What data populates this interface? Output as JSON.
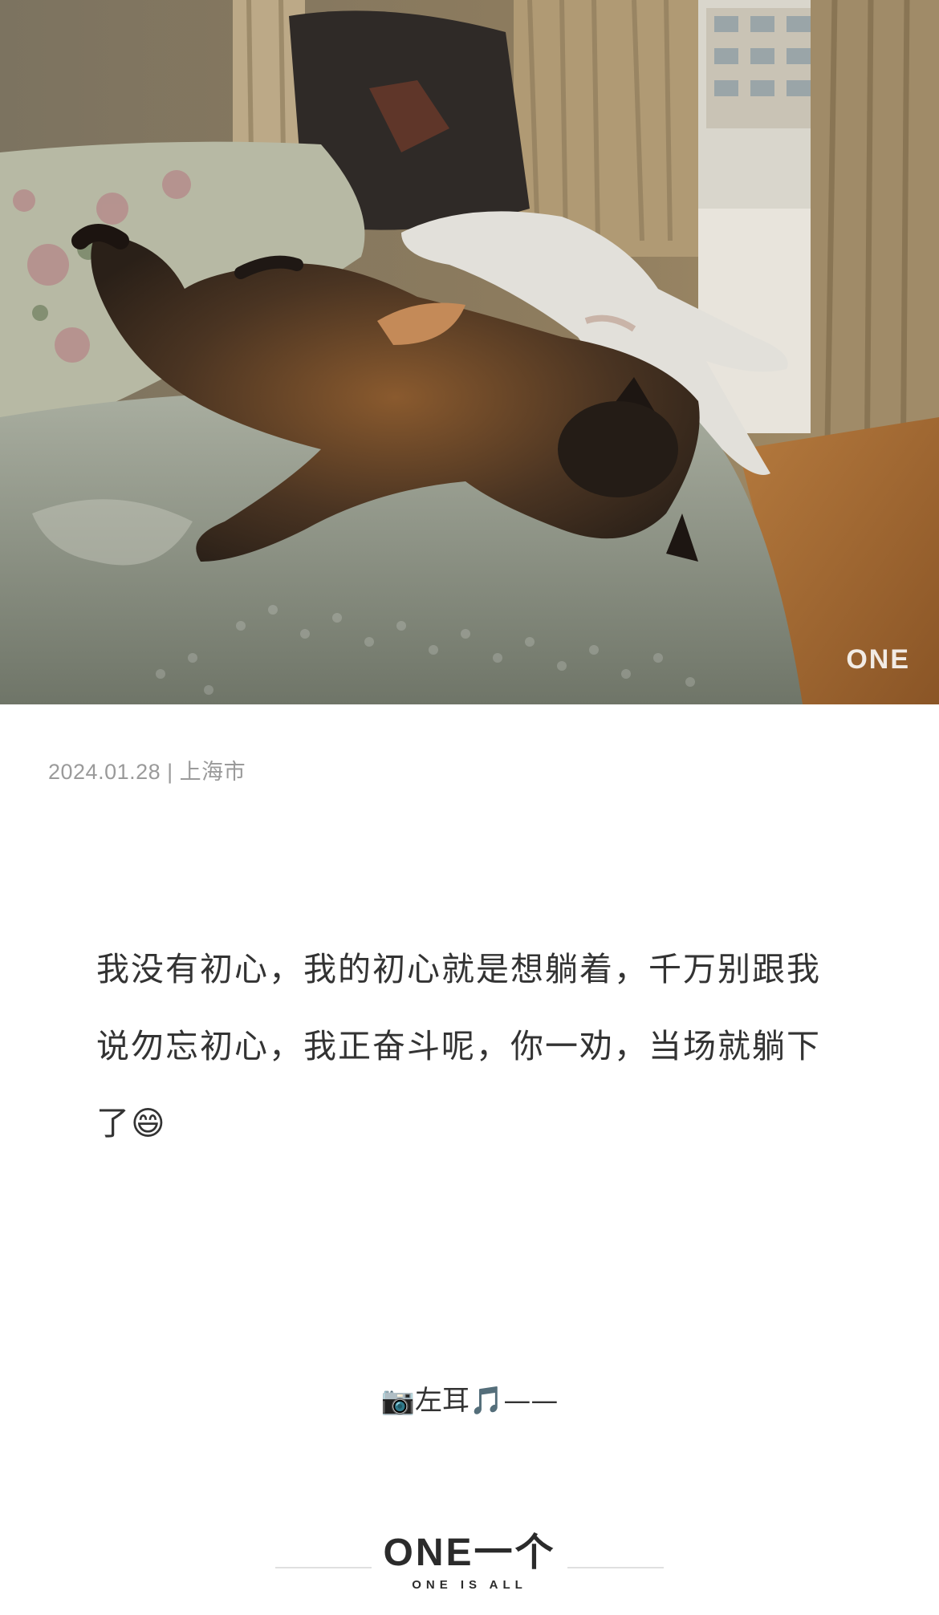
{
  "photo": {
    "watermark": "ONE"
  },
  "meta": {
    "date": "2024.01.28",
    "separator": "|",
    "location": "上海市"
  },
  "body": {
    "text": "我没有初心，我的初心就是想躺着，千万别跟我说勿忘初心，我正奋斗呢，你一劝，当场就躺下了😄"
  },
  "author": {
    "text": "📷左耳🎵——"
  },
  "footer": {
    "logo": "ONE一个",
    "slogan": "ONE IS ALL"
  }
}
